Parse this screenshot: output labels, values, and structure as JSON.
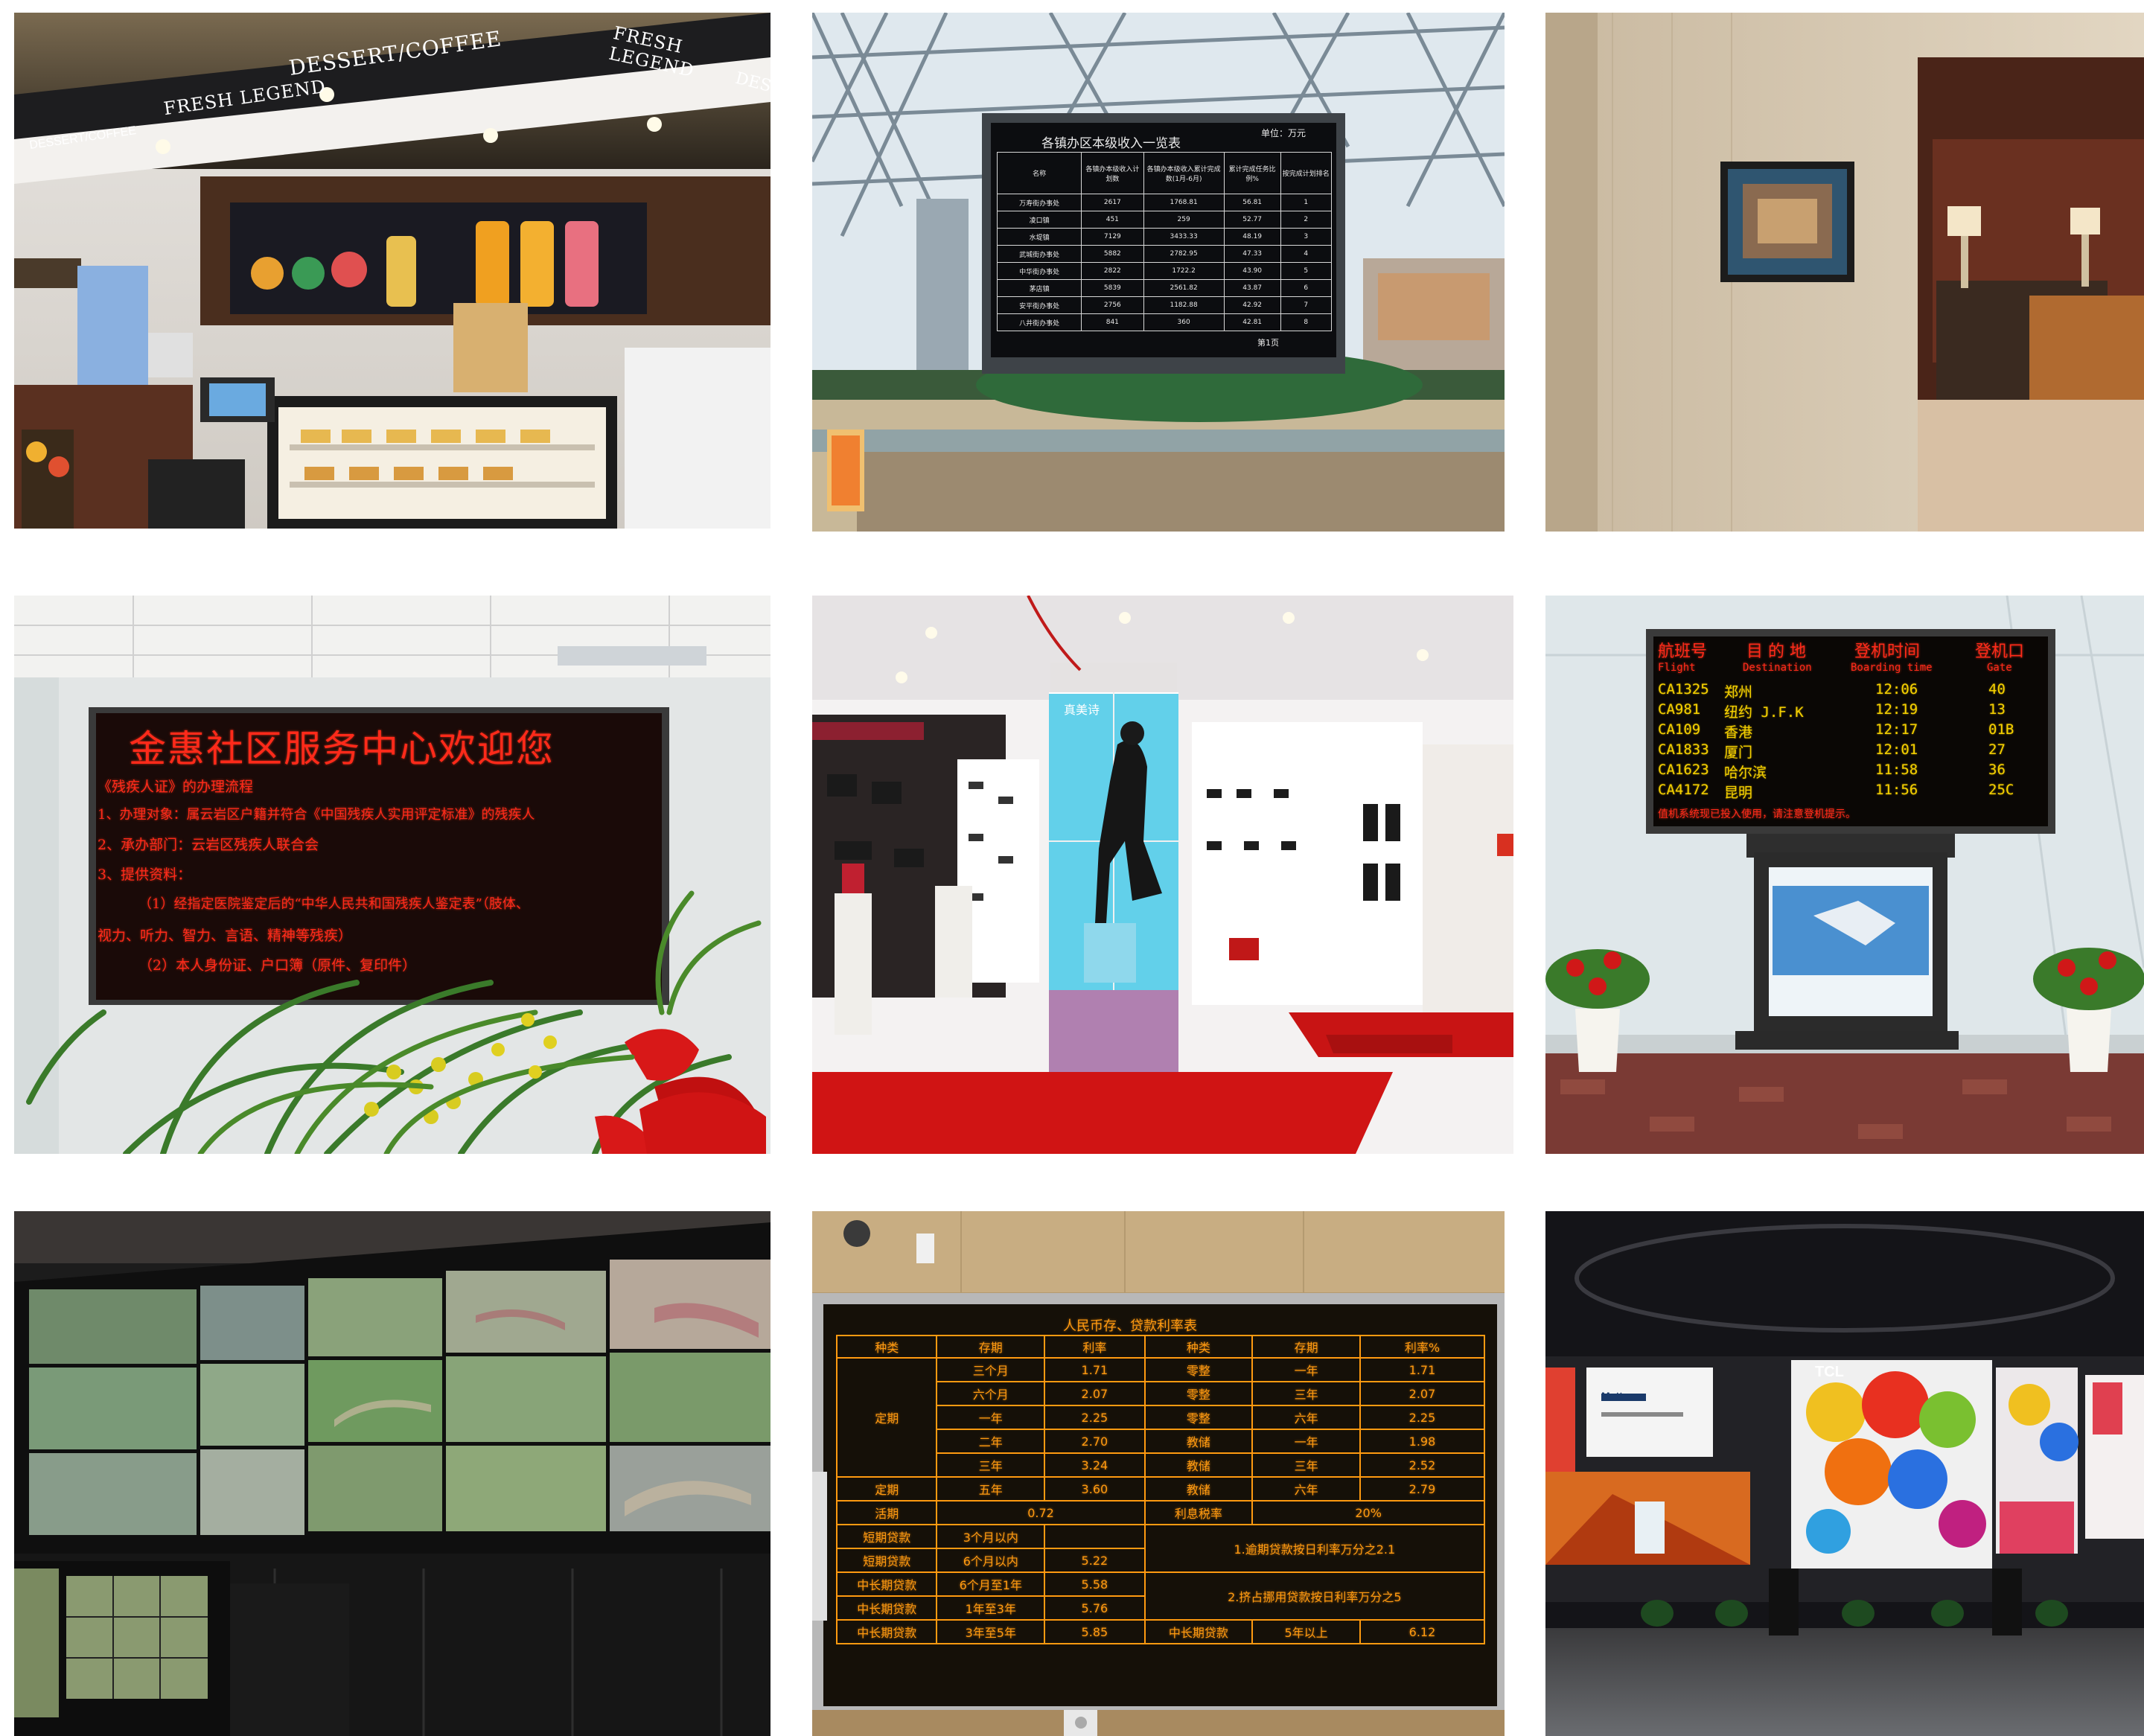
{
  "coffee": {
    "signs": [
      "DESSERT/COFFEE",
      "FRESH LEGEND",
      "DESSERT/COFFEE",
      "FRESH LEGEND",
      "DESSE"
    ]
  },
  "finance": {
    "title": "各镇办区本级收入一览表",
    "unit": "单位：万元",
    "headers": [
      "名称",
      "各镇办本级收入计划数",
      "各镇办本级收入累计完成数(1月-6月)",
      "累计完成任务比例%",
      "按完成计划排名"
    ],
    "rows": [
      [
        "万寿街办事处",
        "2617",
        "1768.81",
        "56.81",
        "1"
      ],
      [
        "凌口镇",
        "451",
        "259",
        "52.77",
        "2"
      ],
      [
        "水堤镇",
        "7129",
        "3433.33",
        "48.19",
        "3"
      ],
      [
        "武城街办事处",
        "5882",
        "2782.95",
        "47.33",
        "4"
      ],
      [
        "中华街办事处",
        "2822",
        "1722.2",
        "43.90",
        "5"
      ],
      [
        "茅店镇",
        "5839",
        "2561.82",
        "43.87",
        "6"
      ],
      [
        "安平街办事处",
        "2756",
        "1182.88",
        "42.92",
        "7"
      ],
      [
        "八井街办事处",
        "841",
        "360",
        "42.81",
        "8"
      ]
    ],
    "page": "第1页"
  },
  "community": {
    "title": "金惠社区服务中心欢迎您",
    "lines": [
      "《残疾人证》的办理流程",
      "1、办理对象：属云岩区户籍并符合《中国残疾人实用评定标准》的残疾人",
      "2、承办部门：云岩区残疾人联合会",
      "3、提供资料：",
      "（1）经指定医院鉴定后的“中华人民共和国残疾人鉴定表”（肢体、",
      "视力、听力、智力、言语、精神等残疾）",
      "（2）本人身份证、户口簿（原件、复印件）"
    ]
  },
  "store": {
    "poster_text": "真美诗"
  },
  "flight": {
    "headers_cn": [
      "航班号",
      "目 的 地",
      "登机时间",
      "登机口"
    ],
    "headers_en": [
      "Flight",
      "Destination",
      "Boarding time",
      "Gate"
    ],
    "rows": [
      [
        "CA1325",
        "郑州",
        "12:06",
        "40"
      ],
      [
        "CA981",
        "纽约 J.F.K",
        "12:19",
        "13"
      ],
      [
        "CA109",
        "香港",
        "12:17",
        "01B"
      ],
      [
        "CA1833",
        "厦门",
        "12:01",
        "27"
      ],
      [
        "CA1623",
        "哈尔滨",
        "11:58",
        "36"
      ],
      [
        "CA4172",
        "昆明",
        "11:56",
        "25C"
      ]
    ],
    "footer": "值机系统现已投入使用，请注意登机提示。"
  },
  "rates": {
    "title": "人民币存、贷款利率表",
    "header": [
      "种类",
      "存期",
      "利率",
      "种类",
      "存期",
      "利率%"
    ],
    "rows": [
      [
        "",
        "三个月",
        "1.71",
        "零整",
        "一年",
        "1.71"
      ],
      [
        "",
        "六个月",
        "2.07",
        "零整",
        "三年",
        "2.07"
      ],
      [
        "定期",
        "一年",
        "2.25",
        "零整",
        "六年",
        "2.25"
      ],
      [
        "",
        "二年",
        "2.70",
        "教储",
        "一年",
        "1.98"
      ],
      [
        "",
        "三年",
        "3.24",
        "教储",
        "三年",
        "2.52"
      ],
      [
        "定期",
        "五年",
        "3.60",
        "教储",
        "六年",
        "2.79"
      ]
    ],
    "huoqi": [
      "活期",
      "0.72",
      "利息税率",
      "20%"
    ],
    "loans": [
      [
        "短期贷款",
        "3个月以内",
        ""
      ],
      [
        "短期贷款",
        "6个月以内",
        "5.22"
      ],
      [
        "中长期贷款",
        "6个月至1年",
        "5.58"
      ],
      [
        "中长期贷款",
        "1年至3年",
        "5.76"
      ],
      [
        "中长期贷款",
        "3年至5年",
        "5.85"
      ]
    ],
    "notes": [
      "1.逾期贷款按日利率万分之2.1",
      "2.挤占挪用贷款按日利率万分之5"
    ],
    "last": [
      "中长期贷款",
      "5年以上",
      "6.12"
    ]
  },
  "arena": {
    "brand": "TCL",
    "panel_text": "Mattress"
  }
}
